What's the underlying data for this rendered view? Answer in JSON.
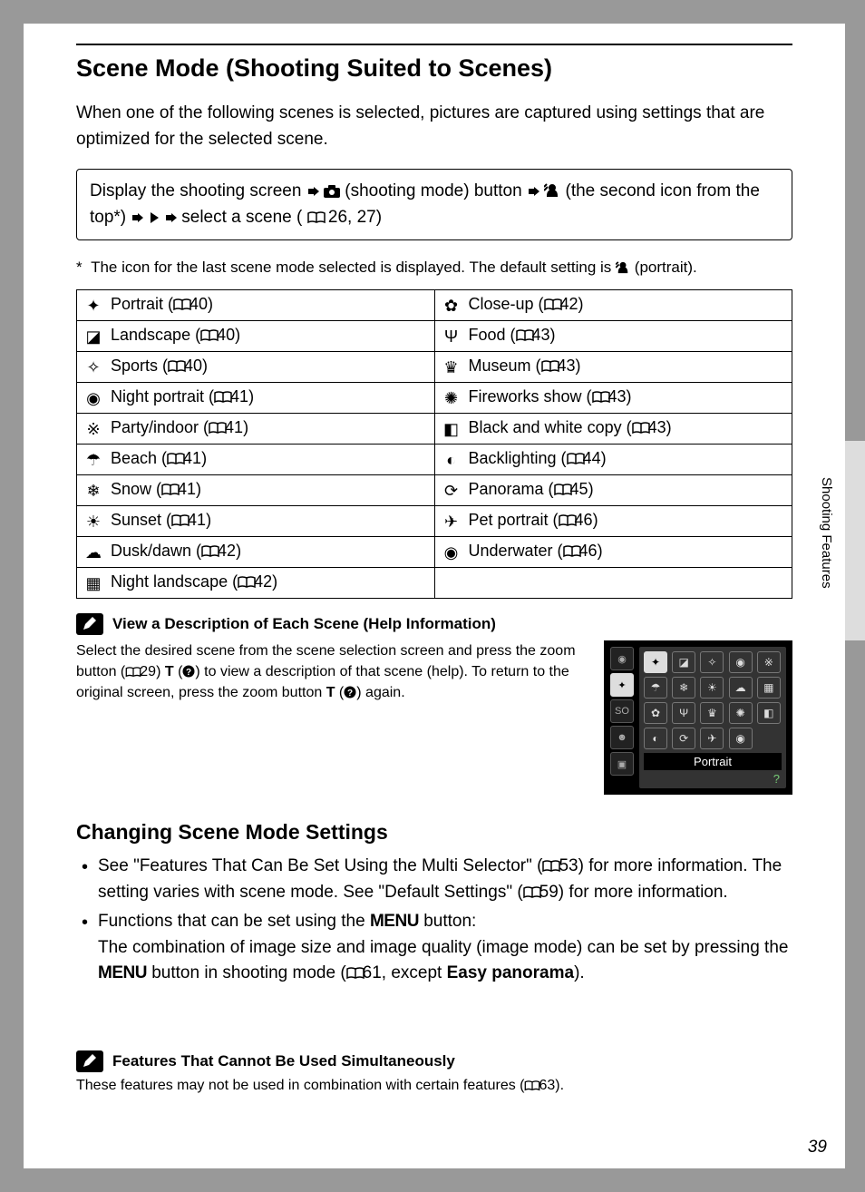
{
  "title": "Scene Mode (Shooting Suited to Scenes)",
  "intro": "When one of the following scenes is selected, pictures are captured using settings that are optimized for the selected scene.",
  "instr": {
    "t1": "Display the shooting screen ",
    "t2": " (shooting mode) button ",
    "t3": " (the second icon from the top*) ",
    "t4": " select a scene (",
    "t5": "26, 27)"
  },
  "footnote": {
    "prefix": "*",
    "text": "The icon for the last scene mode selected is displayed. The default setting is ",
    "suffix": " (portrait)."
  },
  "scenes": {
    "left": [
      {
        "name": "Portrait",
        "page": "40"
      },
      {
        "name": "Landscape",
        "page": "40"
      },
      {
        "name": "Sports",
        "page": "40"
      },
      {
        "name": "Night portrait",
        "page": "41"
      },
      {
        "name": "Party/indoor",
        "page": "41"
      },
      {
        "name": "Beach",
        "page": "41"
      },
      {
        "name": "Snow",
        "page": "41"
      },
      {
        "name": "Sunset",
        "page": "41"
      },
      {
        "name": "Dusk/dawn",
        "page": "42"
      },
      {
        "name": "Night landscape",
        "page": "42"
      }
    ],
    "right": [
      {
        "name": "Close-up",
        "page": "42"
      },
      {
        "name": "Food",
        "page": "43"
      },
      {
        "name": "Museum",
        "page": "43"
      },
      {
        "name": "Fireworks show",
        "page": "43"
      },
      {
        "name": "Black and white copy",
        "page": "43"
      },
      {
        "name": "Backlighting",
        "page": "44"
      },
      {
        "name": "Panorama",
        "page": "45"
      },
      {
        "name": "Pet portrait",
        "page": "46"
      },
      {
        "name": "Underwater",
        "page": "46"
      }
    ]
  },
  "help": {
    "title": "View a Description of Each Scene (Help Information)",
    "t1": "Select the desired scene from the scene selection screen and press the zoom button (",
    "t2": "29) ",
    "tbold": "T",
    "t3": " (",
    "t4": ") to view a description of that scene (help). To return to the original screen, press the zoom button ",
    "t5": " (",
    "t6": ") again.",
    "diagram_label": "Portrait"
  },
  "subheading": "Changing Scene Mode Settings",
  "bullets": {
    "b1a": "See \"Features That Can Be Set Using the Multi Selector\" (",
    "b1b": "53) for more information. The setting varies with scene mode. See \"Default Settings\" (",
    "b1c": "59) for more information.",
    "b2a": "Functions that can be set using the ",
    "b2menu": "MENU",
    "b2b": " button:",
    "b2c": "The combination of image size and image quality (image mode) can be set by pressing the ",
    "b2d": " button in shooting mode (",
    "b2e": "61, except ",
    "b2bold": "Easy panorama",
    "b2f": ")."
  },
  "note2": {
    "title": "Features That Cannot Be Used Simultaneously",
    "text1": "These features may not be used in combination with certain features (",
    "text2": "63)."
  },
  "sidebar": "Shooting Features",
  "page_number": "39"
}
